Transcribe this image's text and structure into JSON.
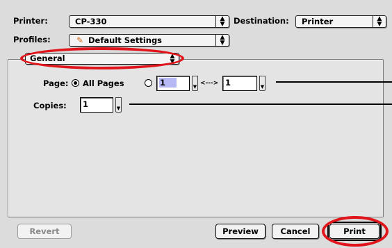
{
  "printer": {
    "label": "Printer:",
    "value": "CP-330"
  },
  "destination": {
    "label": "Destination:",
    "value": "Printer"
  },
  "profiles": {
    "label": "Profiles:",
    "value": "Default Settings"
  },
  "section": {
    "value": "General"
  },
  "page": {
    "label": "Page:",
    "all_pages_label": "All Pages",
    "all_pages_selected": true,
    "from_value": "1",
    "range_separator": "<--->",
    "to_value": "1"
  },
  "copies": {
    "label": "Copies:",
    "value": "1"
  },
  "buttons": {
    "revert": "Revert",
    "preview": "Preview",
    "cancel": "Cancel",
    "print": "Print"
  },
  "annotation_color": "#e1151c",
  "icons": {
    "profile": "pencil-icon",
    "popup": "up-down-arrows-icon",
    "stepper": "stepper-arrow-icon"
  }
}
